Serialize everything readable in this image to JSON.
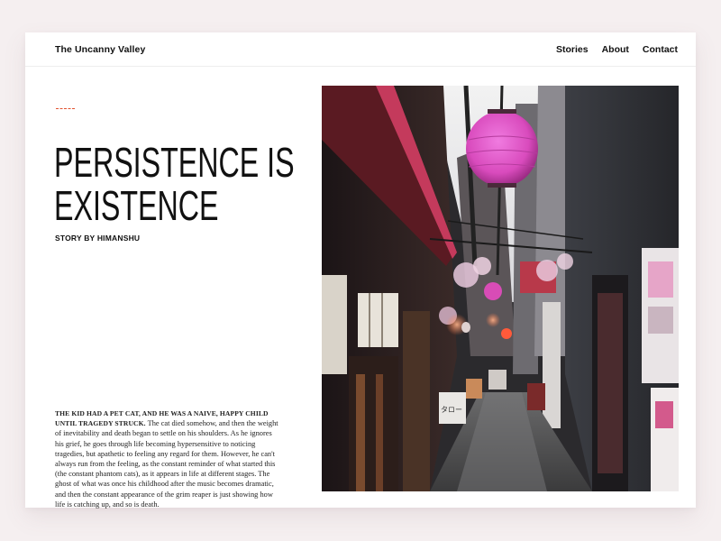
{
  "header": {
    "site_title": "The Uncanny Valley",
    "nav": [
      "Stories",
      "About",
      "Contact"
    ]
  },
  "article": {
    "title_line1": "PERSISTENCE IS",
    "title_line2": "EXISTENCE",
    "byline": "STORY BY HIMANSHU",
    "lead": "The kid had a pet cat, and he was a naive, happy child until tragedy struck.",
    "body": " The cat died somehow, and then the weight of inevitability and death began to settle on his shoulders. As he ignores his grief, he goes through life becoming hypersensitive to noticing tragedies, but apathetic to feeling any regard for them. However, he can't always run from the feeling, as the constant reminder of what started this (the constant phantom cats), as it appears in life at different stages. The ghost of what was once his childhood after the music becomes dramatic, and then the constant appearance of the grim reaper is just showing how life is catching up, and so is death.",
    "sign_text": "タロー"
  },
  "colors": {
    "accent": "#e2522f",
    "background": "#f5eff0",
    "lantern": "#e04fc0"
  }
}
